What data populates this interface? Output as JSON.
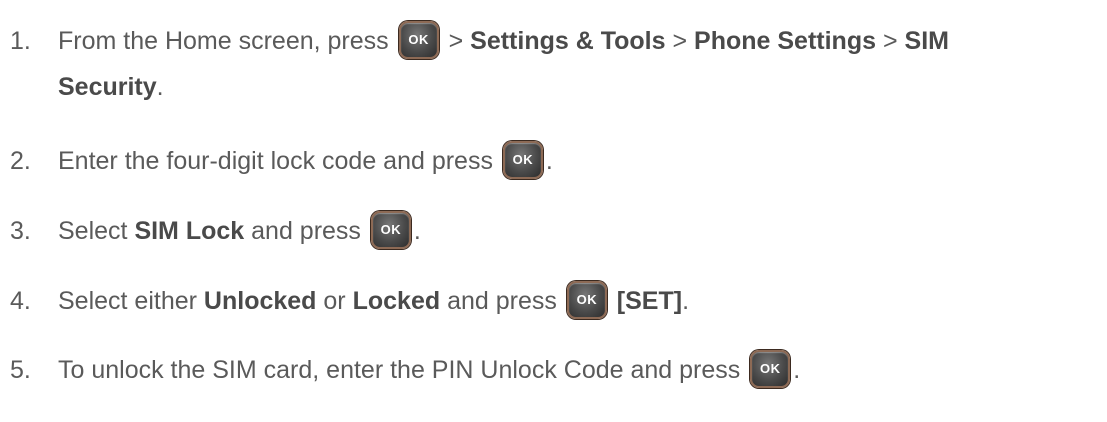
{
  "ok_key_label": "OK",
  "steps": [
    {
      "number": "1.",
      "t1": "From the Home screen, press",
      "t2": ">",
      "b1": "Settings & Tools",
      "t3": ">",
      "b2": "Phone Settings",
      "t4": ">",
      "b3": "SIM",
      "b4": "Security",
      "t5": "."
    },
    {
      "number": "2.",
      "t1": "Enter the four-digit lock code and press",
      "t2": "."
    },
    {
      "number": "3.",
      "t1": "Select",
      "b1": "SIM Lock",
      "t2": "and press",
      "t3": "."
    },
    {
      "number": "4.",
      "t1": "Select either",
      "b1": "Unlocked",
      "t2": "or",
      "b2": "Locked",
      "t3": "and press",
      "b3": "[SET]",
      "t4": "."
    },
    {
      "number": "5.",
      "t1": "To unlock the SIM card, enter the PIN Unlock Code and press",
      "t2": "."
    }
  ]
}
